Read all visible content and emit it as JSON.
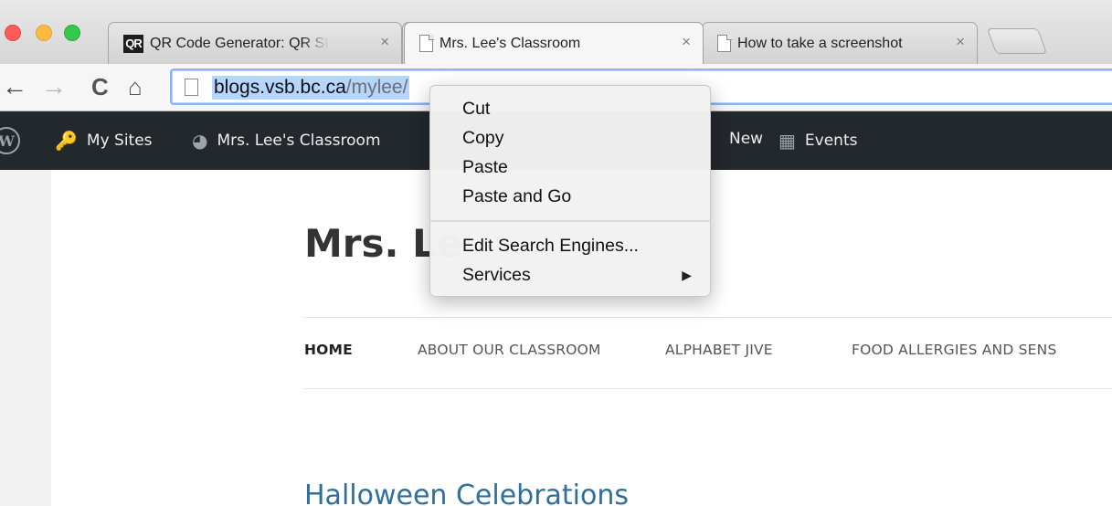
{
  "browser": {
    "tabs": [
      {
        "title": "QR Code Generator: QR St",
        "favicon": "qr-favicon",
        "active": false
      },
      {
        "title": "Mrs. Lee's Classroom",
        "favicon": "page-icon",
        "active": true
      },
      {
        "title": "How to take a screenshot",
        "favicon": "page-icon",
        "active": false
      }
    ],
    "tab_close_glyph": "×",
    "qr_favicon_text": "QR",
    "nav": {
      "back_glyph": "←",
      "forward_glyph": "→",
      "reload_glyph": "C",
      "home_glyph": "⌂"
    },
    "address": {
      "host": "blogs.vsb.bc.ca",
      "path": "/mylee/"
    }
  },
  "adminbar": {
    "logo_glyph": "W",
    "items": [
      {
        "label": "My Sites",
        "icon": "key-icon",
        "glyph": "🔑"
      },
      {
        "label": "Mrs. Lee's Classroom",
        "icon": "dashboard-icon",
        "glyph": "◕"
      },
      {
        "label": "New",
        "icon": "plus-icon",
        "glyph": ""
      },
      {
        "label": "Events",
        "icon": "calendar-icon",
        "glyph": "▦"
      }
    ],
    "colors": {
      "background": "#23282d",
      "icon": "#9ea3a8"
    }
  },
  "page": {
    "site_title": "Mrs. Le",
    "nav_items": [
      "HOME",
      "ABOUT OUR CLASSROOM",
      "ALPHABET JIVE",
      "FOOD ALLERGIES AND SENS"
    ],
    "post_title": "Halloween Celebrations",
    "colors": {
      "post_title": "#2e6f9e"
    }
  },
  "context_menu": {
    "items": [
      "Cut",
      "Copy",
      "Paste",
      "Paste and Go",
      "Edit Search Engines...",
      "Services"
    ],
    "submenu_arrow": "▶"
  }
}
